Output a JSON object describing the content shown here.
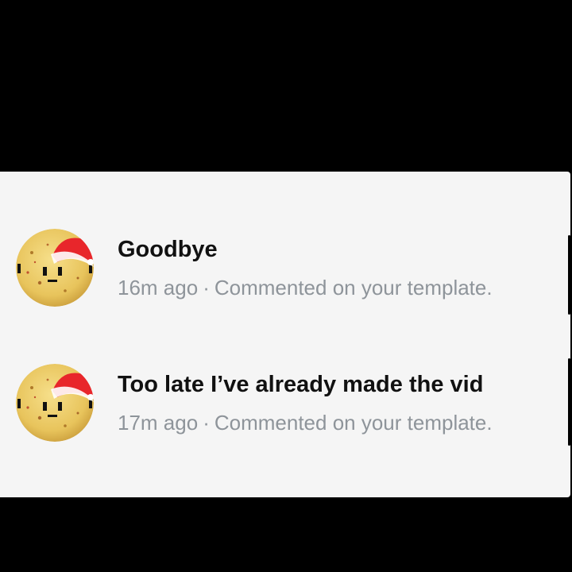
{
  "notifications": [
    {
      "message": "Goodbye",
      "time": "16m ago",
      "separator": "·",
      "action": "Commented on your template.",
      "avatar_icon": "potato-santa-hat-avatar-icon"
    },
    {
      "message": "Too late I’ve already made the vid",
      "time": "17m ago",
      "separator": "·",
      "action": "Commented on your template.",
      "avatar_icon": "potato-santa-hat-avatar-icon"
    }
  ],
  "colors": {
    "background": "#000000",
    "panel": "#f5f5f5",
    "title_text": "#111111",
    "meta_text": "#8e949a",
    "hat_red": "#e8262b",
    "avatar_yellow": "#f0d06a"
  }
}
